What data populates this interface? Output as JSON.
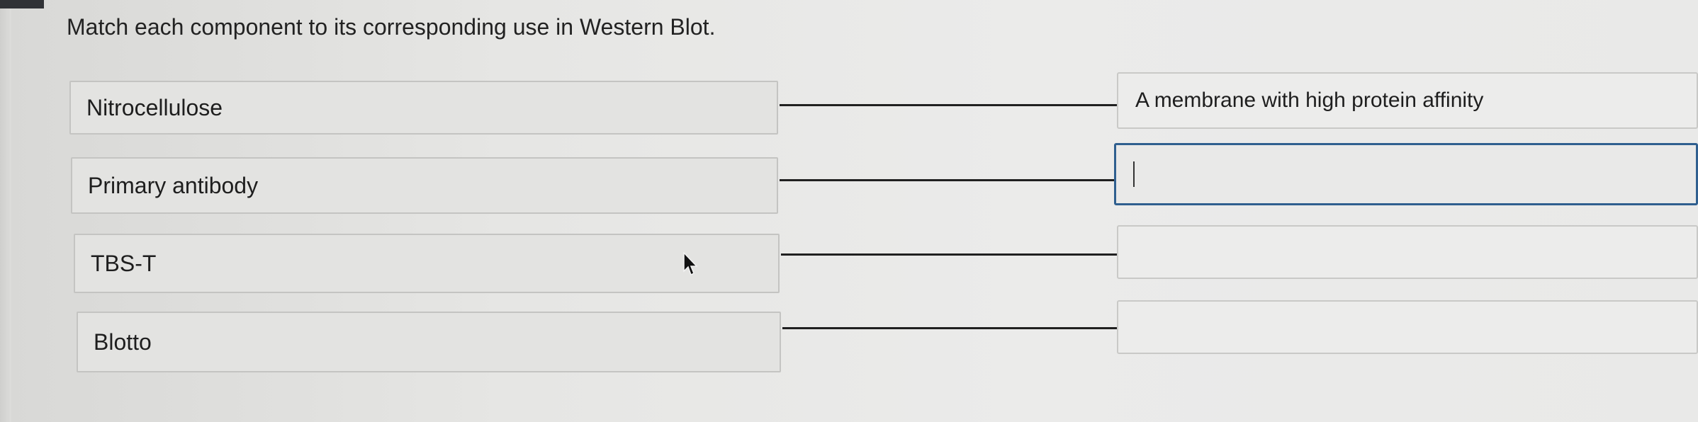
{
  "question": {
    "text": "Match each component to its corresponding use in Western Blot."
  },
  "pairs": [
    {
      "premise": "Nitrocellulose",
      "answer": "A membrane with high protein affinity",
      "answer_focused": false
    },
    {
      "premise": "Primary antibody",
      "answer": "",
      "answer_focused": true
    },
    {
      "premise": "TBS-T",
      "answer": "",
      "answer_focused": false
    },
    {
      "premise": "Blotto",
      "answer": "",
      "answer_focused": false
    }
  ],
  "colors": {
    "focus_border": "#2f5f8f",
    "connector": "#202020"
  },
  "icons": {
    "pointer": "mouse-pointer-icon",
    "text_caret": "text-caret-icon"
  }
}
